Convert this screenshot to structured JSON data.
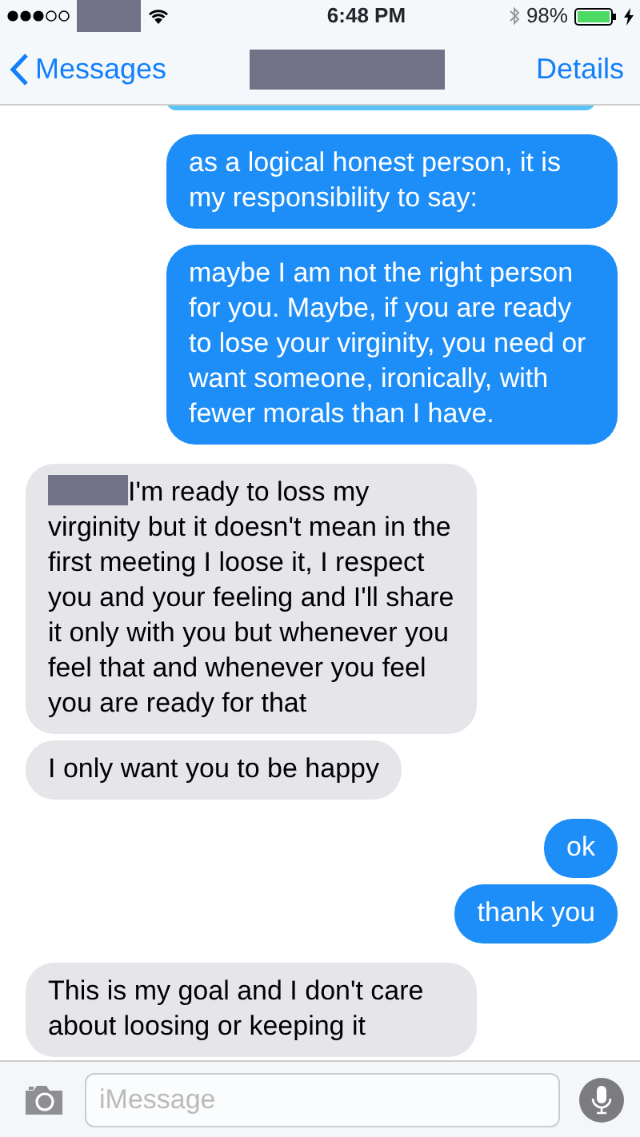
{
  "status_bar": {
    "time": "6:48 PM",
    "battery": "98%",
    "charging": true
  },
  "nav": {
    "back": "Messages",
    "action": "Details"
  },
  "messages": [
    {
      "outgoing": true,
      "text": "as a logical honest person, it is my responsibility to say:",
      "redacted_lead": false
    },
    {
      "outgoing": true,
      "text": "maybe I am not the right person for you. Maybe, if you are ready to lose your virginity, you need or want someone, ironically, with fewer morals than I have.",
      "redacted_lead": false
    },
    {
      "outgoing": false,
      "text": "I'm ready to loss my virginity but it doesn't mean in the first meeting I loose it, I respect you and your feeling and I'll share it only with you but whenever you feel that and whenever you feel you are ready for that",
      "redacted_lead": true
    },
    {
      "outgoing": false,
      "text": "I only want you to be happy",
      "redacted_lead": false
    },
    {
      "outgoing": true,
      "text": "ok",
      "redacted_lead": false
    },
    {
      "outgoing": true,
      "text": "thank you",
      "redacted_lead": false
    },
    {
      "outgoing": false,
      "text": "This is my goal and I don't care about loosing or keeping it",
      "redacted_lead": false
    }
  ],
  "composer": {
    "placeholder": "iMessage"
  }
}
